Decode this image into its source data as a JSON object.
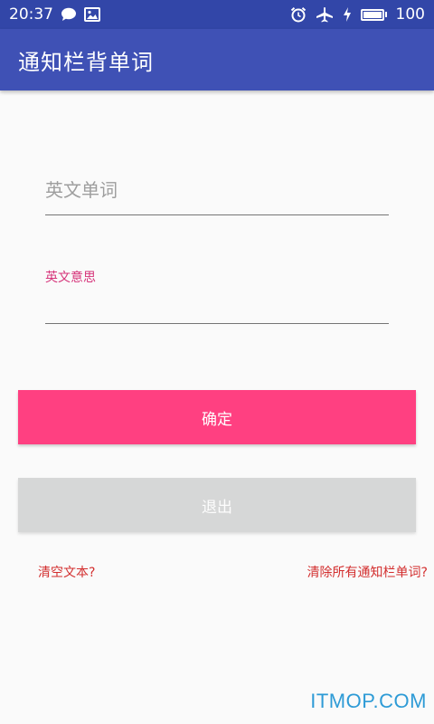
{
  "status_bar": {
    "time": "20:37",
    "battery_level": "100",
    "left_icons": [
      "chat-bubble-icon",
      "image-icon"
    ],
    "right_icons": [
      "alarm-icon",
      "airplane-icon",
      "charging-icon",
      "battery-icon"
    ]
  },
  "app_bar": {
    "title": "通知栏背单词"
  },
  "form": {
    "word_placeholder": "英文单词",
    "word_value": "",
    "meaning_label": "英文意思",
    "meaning_value": ""
  },
  "buttons": {
    "confirm_label": "确定",
    "exit_label": "退出"
  },
  "links": {
    "clear_text": "清空文本?",
    "clear_all": "清除所有通知栏单词?"
  },
  "watermark": "ITMOP.COM",
  "colors": {
    "status_bar": "#3246a8",
    "app_bar": "#3f51b5",
    "accent": "#ff4081",
    "disabled_button": "#d6d7d7",
    "link": "#d32f2f",
    "float_label": "#d6347a"
  }
}
